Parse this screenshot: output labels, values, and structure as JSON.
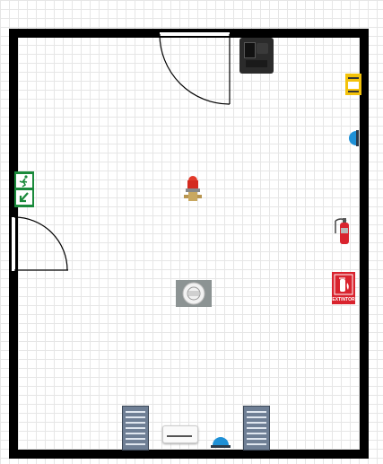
{
  "floorplan": {
    "room": {
      "wall_color": "#000000",
      "grid_color": "#e6e6e6"
    },
    "doors": [
      {
        "name": "door-top",
        "swing": "inward"
      },
      {
        "name": "door-left",
        "swing": "inward"
      }
    ],
    "devices": [
      {
        "name": "access-control-panel-icon"
      },
      {
        "name": "warning-sign-icon"
      },
      {
        "name": "beacon-wall-icon"
      },
      {
        "name": "emergency-exit-sign-icon"
      },
      {
        "name": "strobe-siren-icon"
      },
      {
        "name": "fire-extinguisher-icon"
      },
      {
        "name": "smoke-detector-icon"
      },
      {
        "name": "extintor-sign-icon"
      },
      {
        "name": "server-rack-left-icon"
      },
      {
        "name": "air-conditioner-icon"
      },
      {
        "name": "beacon-floor-icon"
      },
      {
        "name": "server-rack-right-icon"
      }
    ],
    "sign_text": {
      "extintor": "EXTINTOR"
    }
  }
}
